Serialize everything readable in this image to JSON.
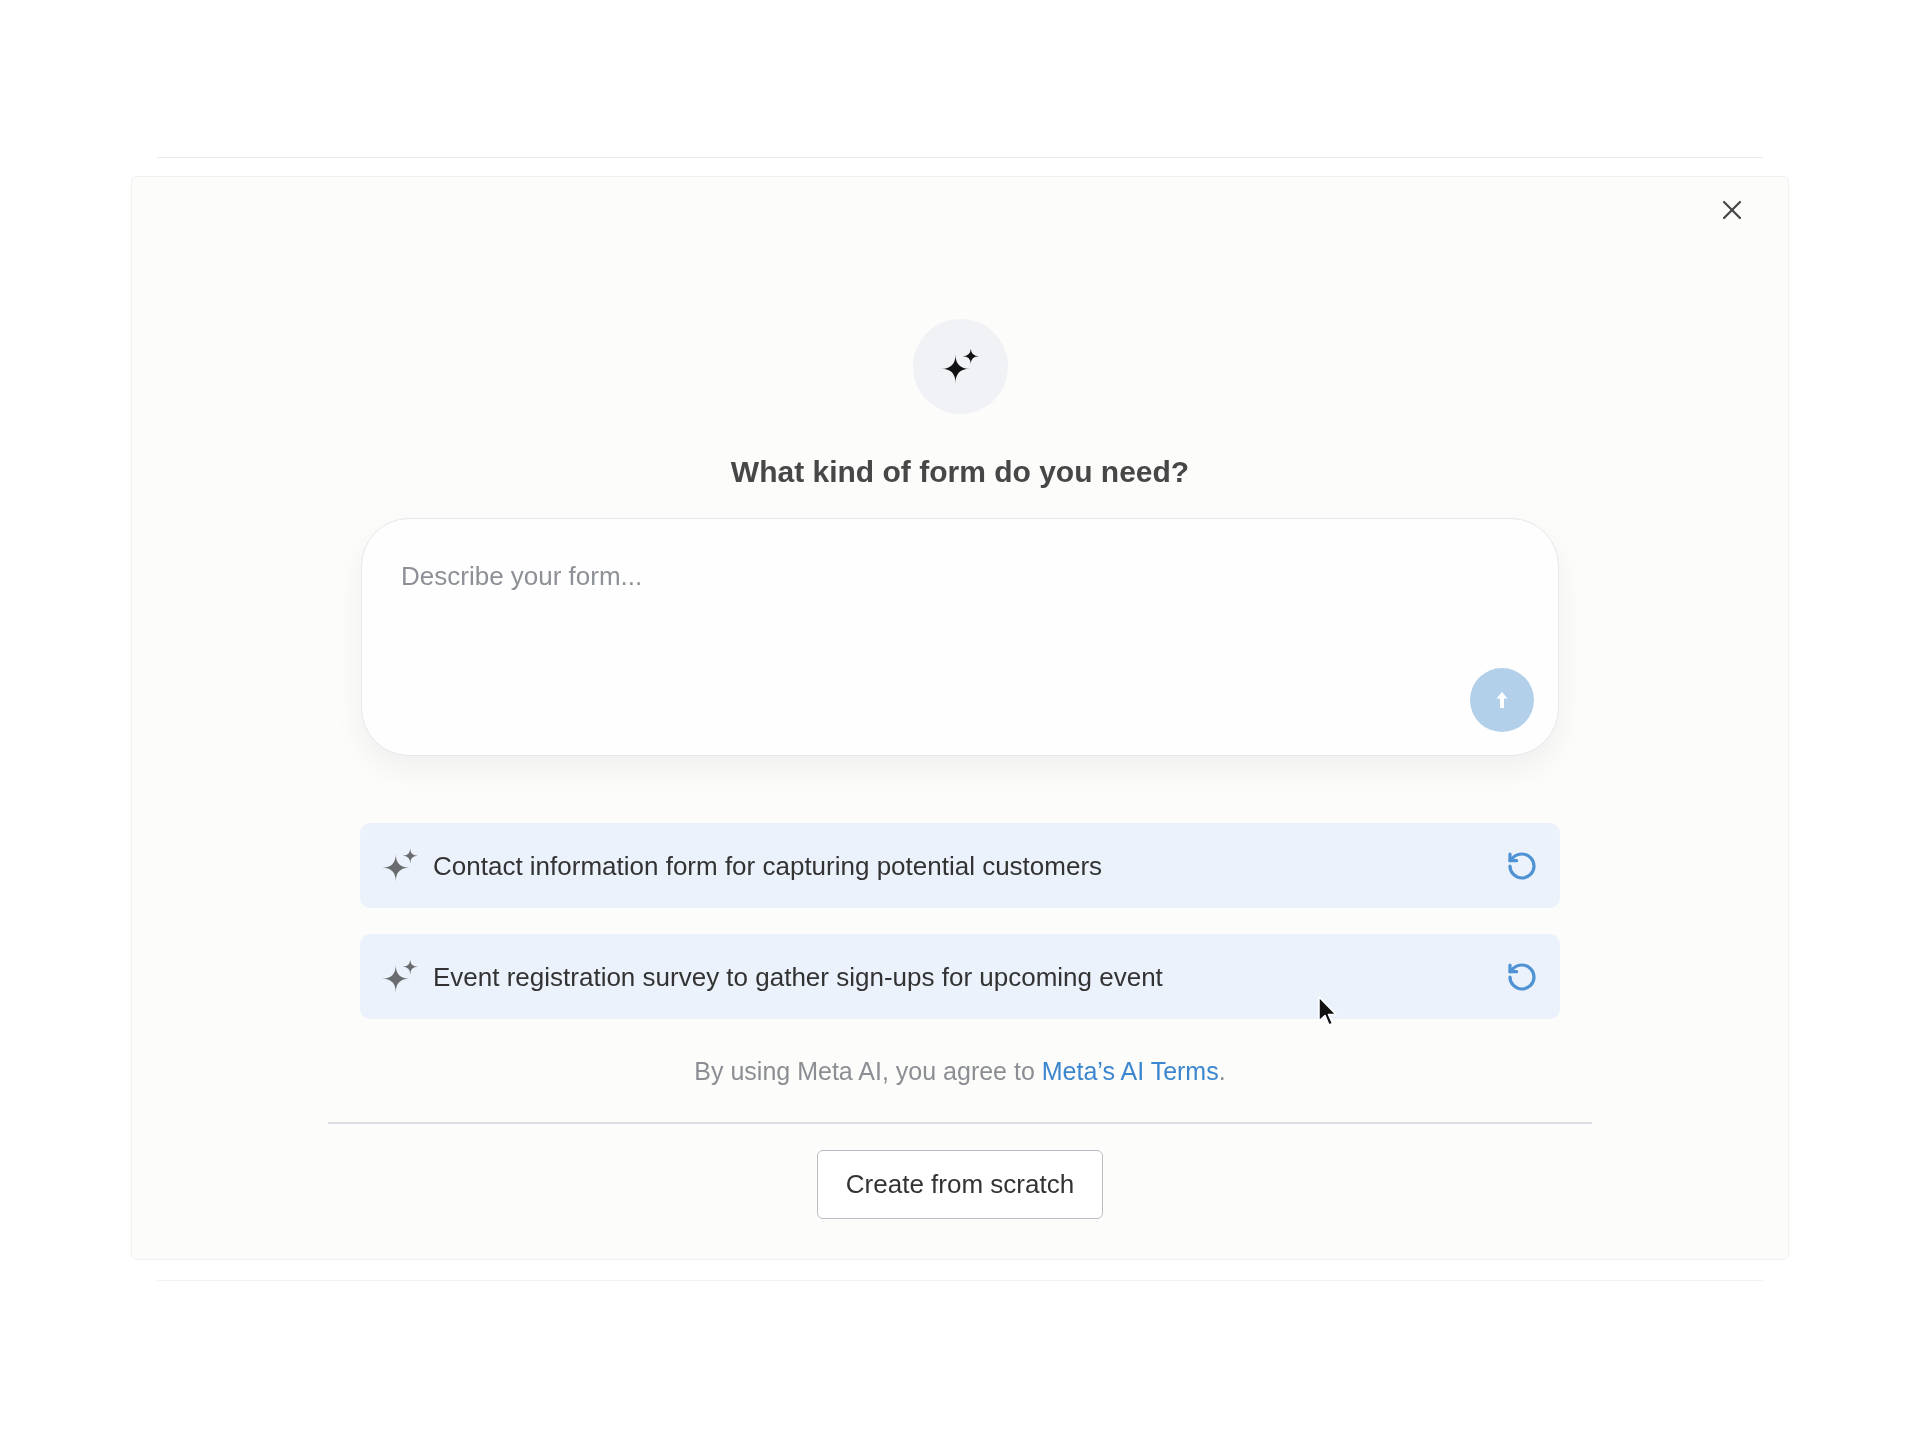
{
  "dialog": {
    "heading": "What kind of form do you need?",
    "prompt": {
      "placeholder": "Describe your form..."
    },
    "send_button": {
      "disabled": true
    },
    "suggestions": [
      {
        "text": "Contact information form for capturing potential customers"
      },
      {
        "text": "Event registration survey to gather sign-ups for upcoming event"
      }
    ],
    "terms": {
      "text": "By using Meta AI, you agree to",
      "link": "Meta’s AI Terms",
      "end": "."
    },
    "secondary_button": "Create from scratch"
  }
}
